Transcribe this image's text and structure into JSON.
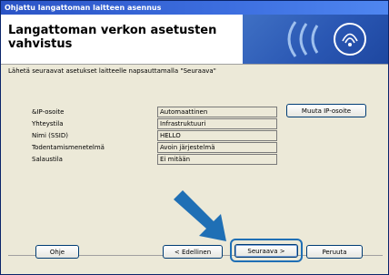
{
  "window": {
    "title": "Ohjattu langattoman laitteen asennus"
  },
  "header": {
    "title": "Langattoman verkon asetusten vahvistus"
  },
  "instruction": "Lähetä seuraavat asetukset laitteelle napsauttamalla \"Seuraava\"",
  "settings": [
    {
      "label": "&IP-osoite",
      "value": "Automaattinen"
    },
    {
      "label": "Yhteystila",
      "value": "Infrastruktuuri"
    },
    {
      "label": "Nimi (SSID)",
      "value": "HELLO"
    },
    {
      "label": "Todentamismenetelmä",
      "value": "Avoin järjestelmä"
    },
    {
      "label": "Salaustila",
      "value": "Ei mitään"
    }
  ],
  "buttons": {
    "change_ip": "Muuta IP-osoite",
    "help": "Ohje",
    "back": "< Edellinen",
    "next": "Seuraava >",
    "cancel": "Peruuta"
  },
  "colors": {
    "arrow": "#1f6fb5",
    "highlight": "#1f6fb5",
    "titlebar": "#2b54c6"
  }
}
